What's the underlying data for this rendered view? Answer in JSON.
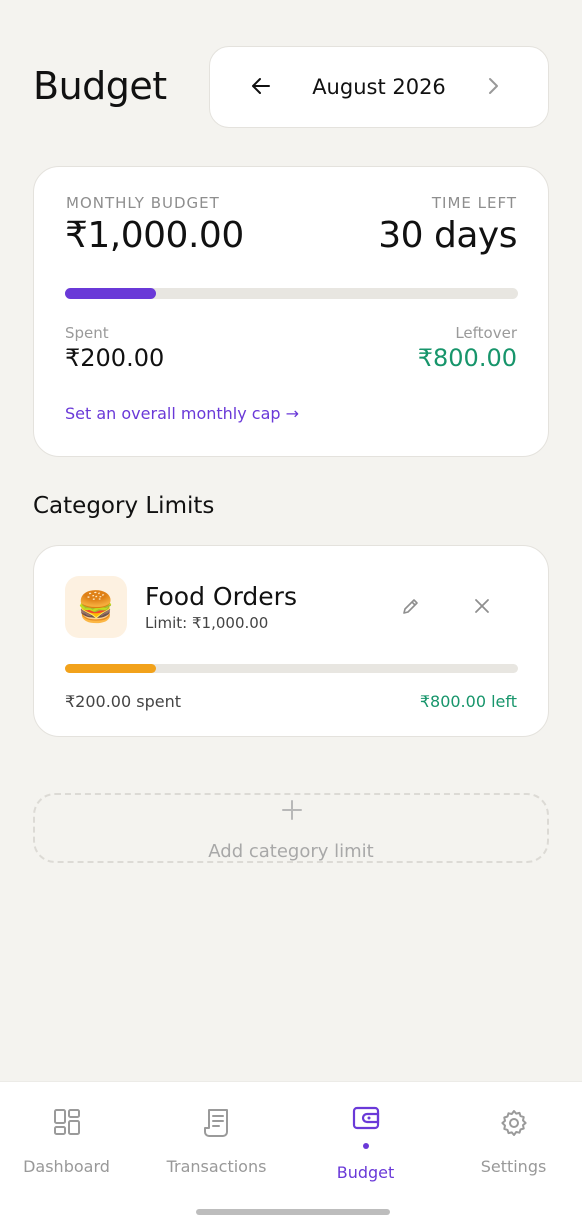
{
  "header": {
    "title": "Budget",
    "month": "August 2026",
    "prev_icon": "arrow-left-icon",
    "next_icon": "chevron-right-icon"
  },
  "overview": {
    "budget_label": "MONTHLY BUDGET",
    "budget_amount": "₹1,000.00",
    "time_label": "TIME LEFT",
    "time_value": "30 days",
    "progress_fraction": 0.2,
    "progress_color": "#6a39d8",
    "spent_label": "Spent",
    "spent_amount": "₹200.00",
    "leftover_label": "Leftover",
    "leftover_amount": "₹800.00",
    "cap_link": "Set an overall monthly cap →"
  },
  "categories_title": "Category Limits",
  "categories": [
    {
      "name": "Food Orders",
      "limit": "Limit: ₹1,000.00",
      "emoji": "🍔",
      "progress_fraction": 0.2,
      "progress_color": "#f2a21b",
      "spent": "₹200.00 spent",
      "left": "₹800.00 left",
      "edit_icon": "pencil-icon",
      "remove_icon": "close-icon"
    }
  ],
  "add_category": {
    "label": "Add category limit",
    "icon": "plus-icon"
  },
  "nav": [
    {
      "label": "Dashboard",
      "icon": "dashboard-icon",
      "active": false
    },
    {
      "label": "Transactions",
      "icon": "receipt-icon",
      "active": false
    },
    {
      "label": "Budget",
      "icon": "wallet-icon",
      "active": true
    },
    {
      "label": "Settings",
      "icon": "gear-icon",
      "active": false
    }
  ],
  "colors": {
    "accent": "#6a39d8",
    "positive": "#17956b",
    "background": "#f4f3ef"
  }
}
